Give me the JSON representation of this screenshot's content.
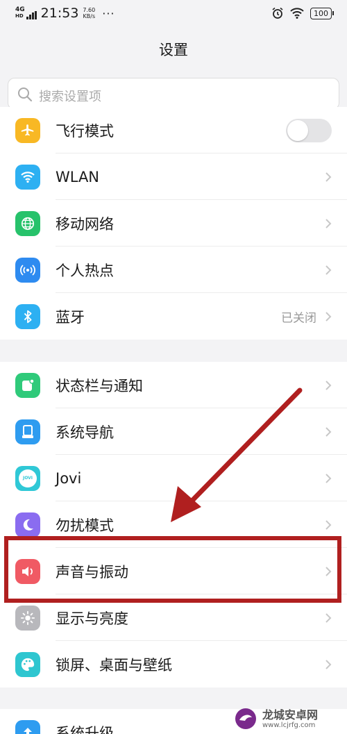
{
  "status_bar": {
    "network": "4G",
    "network_sub": "HD",
    "time": "21:53",
    "speed_value": "7.60",
    "speed_unit": "KB/s",
    "more": "···",
    "battery": "100"
  },
  "page": {
    "title": "设置"
  },
  "search": {
    "placeholder": "搜索设置项"
  },
  "groups": [
    {
      "items": [
        {
          "label": "飞行模式",
          "icon": "airplane-icon",
          "color": "#f8b824",
          "control": "toggle",
          "toggle_on": false
        },
        {
          "label": "WLAN",
          "icon": "wifi-icon",
          "color": "#2db0f2",
          "control": "chevron"
        },
        {
          "label": "移动网络",
          "icon": "globe-icon",
          "color": "#27c26b",
          "control": "chevron"
        },
        {
          "label": "个人热点",
          "icon": "hotspot-icon",
          "color": "#2e8bf0",
          "control": "chevron"
        },
        {
          "label": "蓝牙",
          "icon": "bluetooth-icon",
          "color": "#2db0f2",
          "control": "chevron",
          "value": "已关闭"
        }
      ]
    },
    {
      "items": [
        {
          "label": "状态栏与通知",
          "icon": "notification-icon",
          "color": "#2fca7a",
          "control": "chevron"
        },
        {
          "label": "系统导航",
          "icon": "navigation-icon",
          "color": "#2e9cf0",
          "control": "chevron"
        },
        {
          "label": "Jovi",
          "icon": "jovi-icon",
          "color": "#2fc8d6",
          "control": "chevron",
          "icon_text": "JOVI"
        },
        {
          "label": "勿扰模式",
          "icon": "moon-icon",
          "color": "#8a6cf0",
          "control": "chevron"
        },
        {
          "label": "声音与振动",
          "icon": "speaker-icon",
          "color": "#f05a64",
          "control": "chevron"
        },
        {
          "label": "显示与亮度",
          "icon": "brightness-icon",
          "color": "#b8b8bc",
          "control": "chevron"
        },
        {
          "label": "锁屏、桌面与壁纸",
          "icon": "palette-icon",
          "color": "#2ec6d0",
          "control": "chevron"
        }
      ]
    },
    {
      "items": [
        {
          "label": "系统升级",
          "icon": "upgrade-icon",
          "color": "#2e9cf0",
          "control": "chevron"
        }
      ]
    }
  ],
  "watermark": {
    "brand": "龙城安卓网",
    "url": "www.lcjrfg.com"
  },
  "colors": {
    "annotation": "#b01f1f",
    "background": "#f3f3f5"
  }
}
